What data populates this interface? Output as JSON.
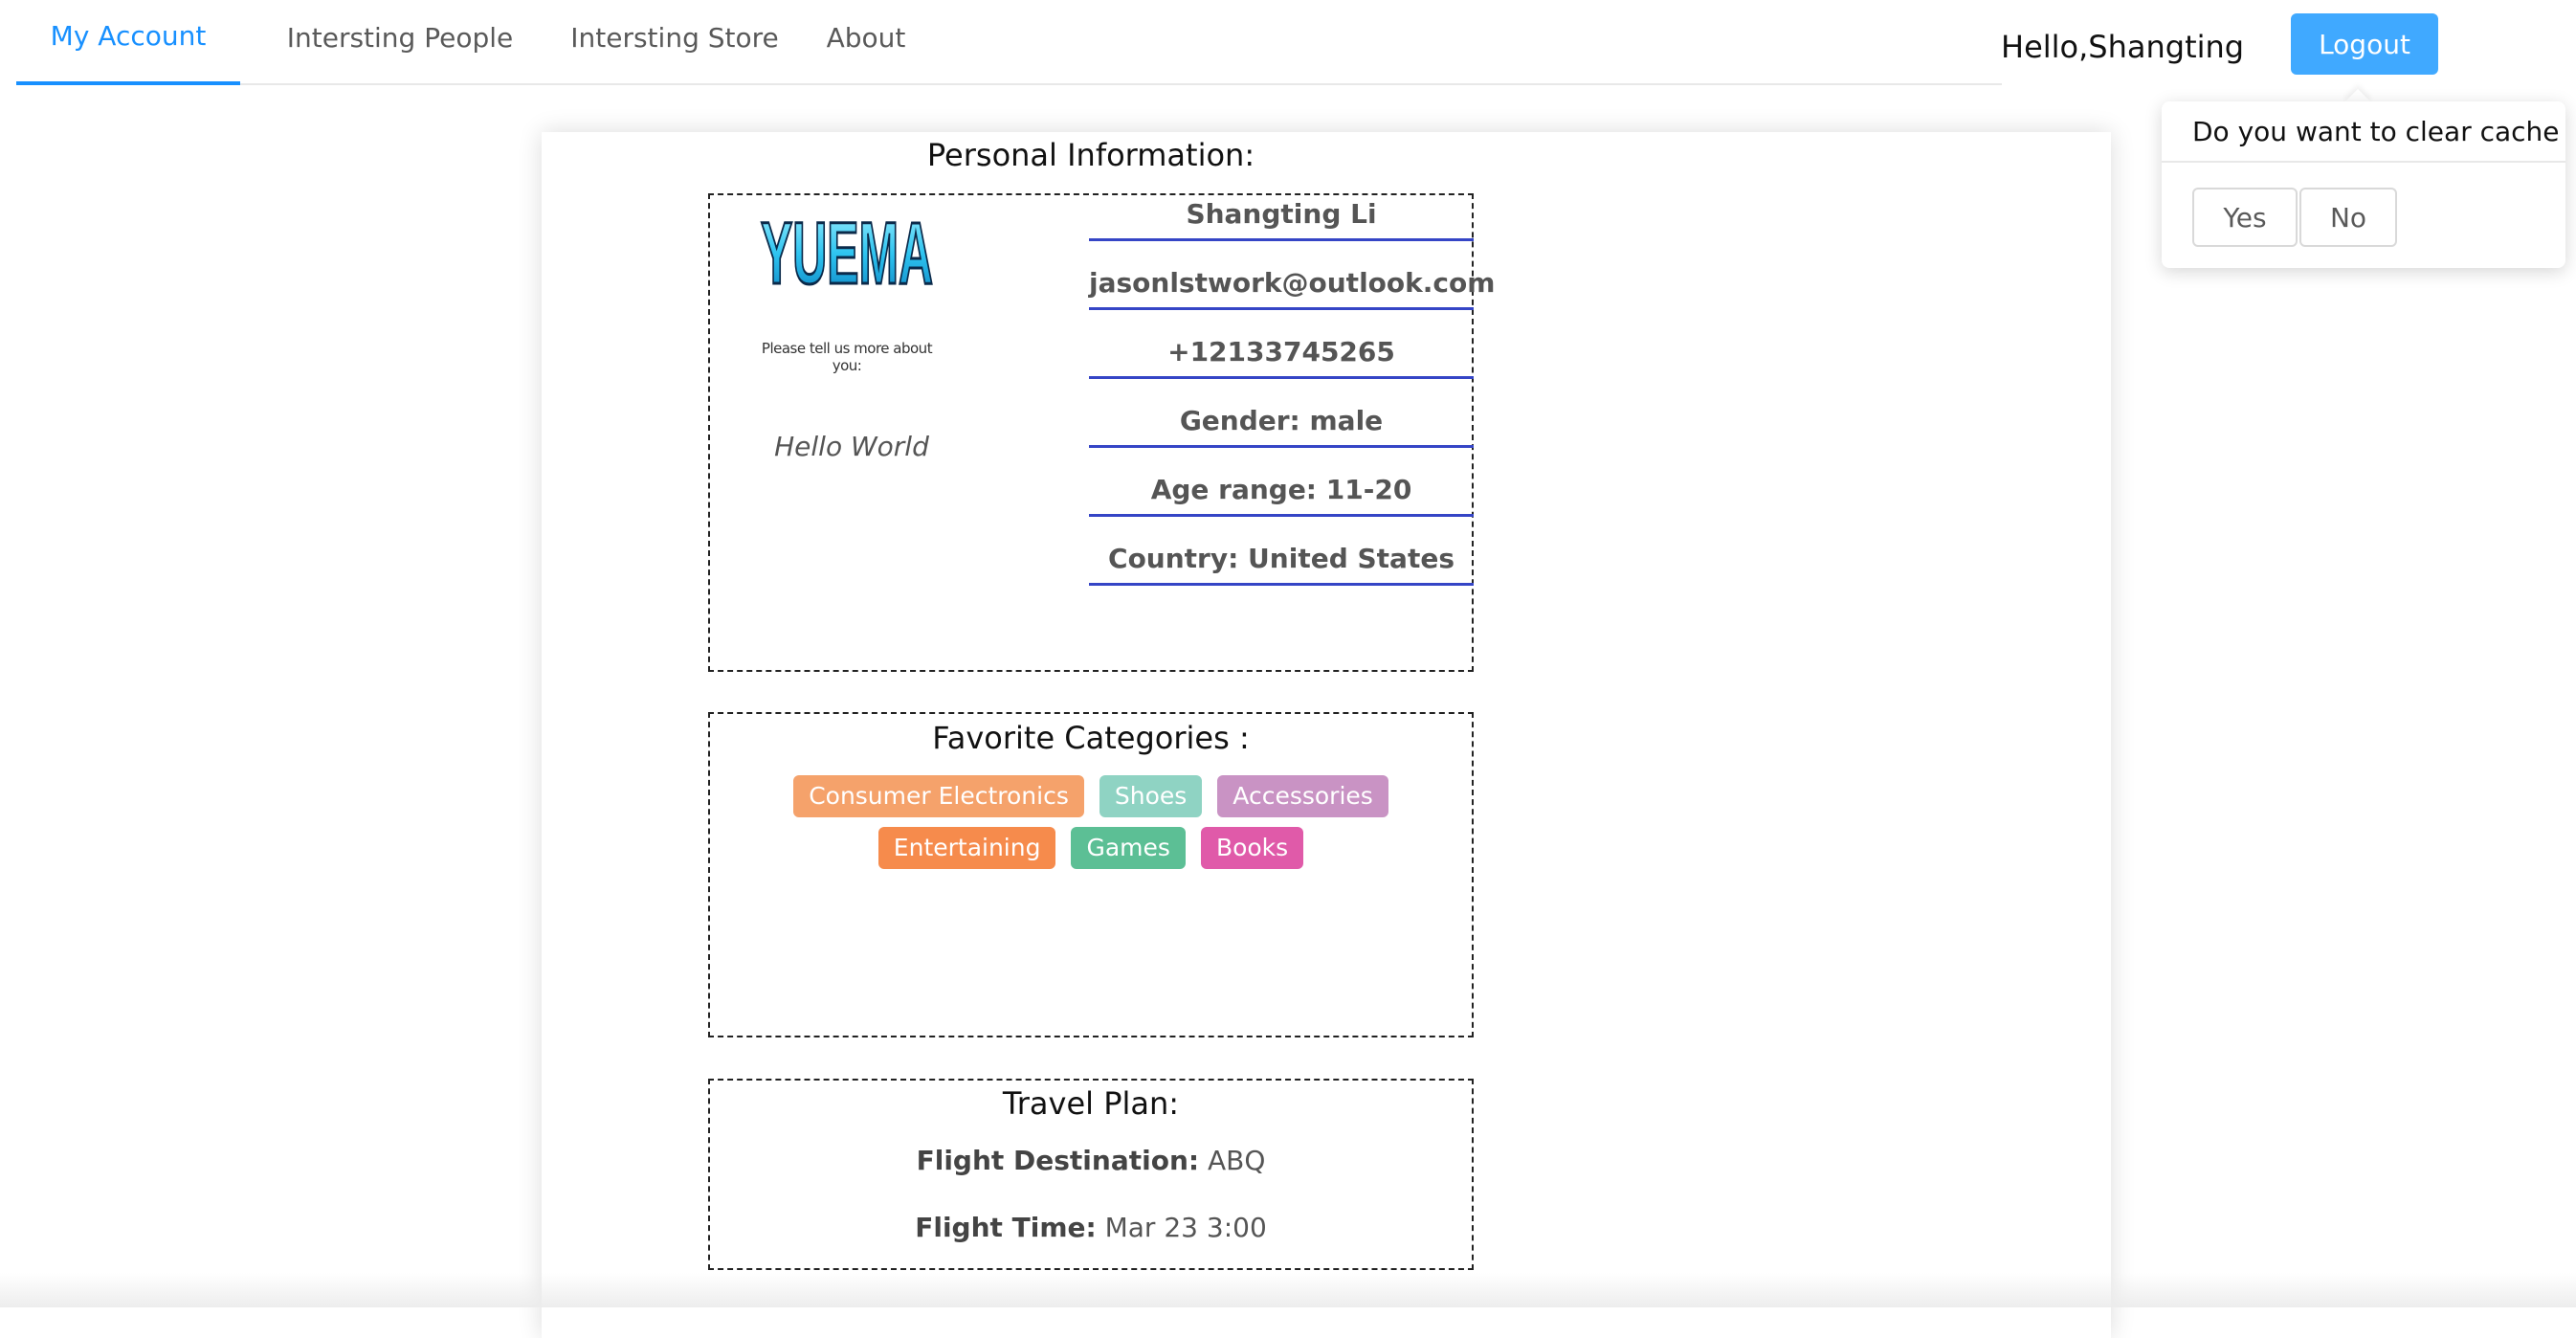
{
  "nav": {
    "tabs": [
      {
        "label": "My Account",
        "active": true
      },
      {
        "label": "Intersting People",
        "active": false
      },
      {
        "label": "Intersting Store",
        "active": false
      },
      {
        "label": "About",
        "active": false
      }
    ],
    "greeting": "Hello,Shangting",
    "logout_label": "Logout"
  },
  "popconfirm": {
    "title": "Do you want to clear cache",
    "yes_label": "Yes",
    "no_label": "No"
  },
  "personal": {
    "heading": "Personal Information:",
    "logo_text": "YUEMA",
    "logo_tagline": "Please tell us more about you:",
    "bio": "Hello World",
    "fields": [
      "Shangting Li",
      "jasonlstwork@outlook.com",
      "+12133745265",
      "Gender: male",
      "Age range: 11-20",
      "Country: United States"
    ]
  },
  "favorites": {
    "heading": "Favorite Categories :",
    "tags": [
      {
        "label": "Consumer Electronics",
        "color": "#f5a26b"
      },
      {
        "label": "Shoes",
        "color": "#8fd3c3"
      },
      {
        "label": "Accessories",
        "color": "#c993c4"
      },
      {
        "label": "Entertaining",
        "color": "#f68b4c"
      },
      {
        "label": "Games",
        "color": "#5cbf95"
      },
      {
        "label": "Books",
        "color": "#e05aa9"
      }
    ]
  },
  "travel": {
    "heading": "Travel Plan:",
    "destination_label": "Flight Destination:",
    "destination_value": " ABQ",
    "time_label": "Flight Time:",
    "time_value": " Mar 23 3:00"
  },
  "colors": {
    "primary": "#1890ff",
    "logout_bg": "#40a9ff",
    "field_underline": "#3545c6"
  }
}
